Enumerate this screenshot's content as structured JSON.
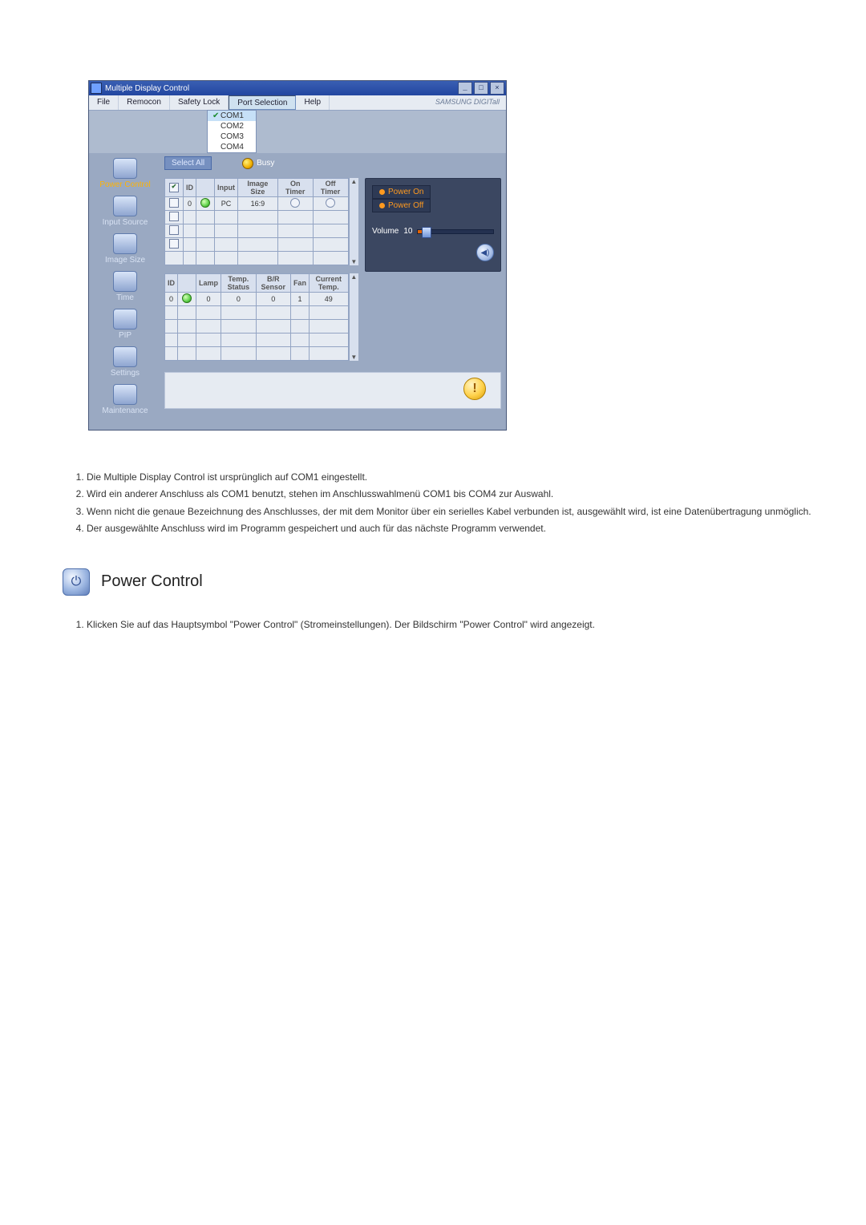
{
  "app": {
    "title": "Multiple Display Control",
    "brand": "SAMSUNG DIGITall",
    "menus": [
      "File",
      "Remocon",
      "Safety Lock",
      "Port Selection",
      "Help"
    ],
    "port_selection_active": true,
    "ports": [
      "COM1",
      "COM2",
      "COM3",
      "COM4"
    ],
    "ports_selected": "COM1",
    "select_all_label": "Select All",
    "busy_label": "Busy",
    "sidebar": [
      {
        "label": "Power Control",
        "active": true
      },
      {
        "label": "Input Source"
      },
      {
        "label": "Image Size"
      },
      {
        "label": "Time"
      },
      {
        "label": "PIP"
      },
      {
        "label": "Settings"
      },
      {
        "label": "Maintenance"
      }
    ],
    "table1": {
      "headers": [
        "",
        "ID",
        "",
        "Input",
        "Image Size",
        "On Timer",
        "Off Timer"
      ],
      "rows": [
        {
          "checked": false,
          "id": "0",
          "power": "on",
          "input": "PC",
          "image_size": "16:9",
          "on_timer": "○",
          "off_timer": "○"
        },
        {
          "checked": false
        },
        {
          "checked": false
        },
        {
          "checked": false
        }
      ]
    },
    "table2": {
      "headers": [
        "ID",
        "",
        "Lamp",
        "Temp. Status",
        "B/R Sensor",
        "Fan",
        "Current Temp."
      ],
      "rows": [
        {
          "id": "0",
          "power": "on",
          "lamp": "0",
          "temp_status": "0",
          "br_sensor": "0",
          "fan": "1",
          "current_temp": "49"
        },
        {},
        {},
        {}
      ]
    },
    "right": {
      "power_on": "Power On",
      "power_off": "Power Off",
      "volume_label": "Volume",
      "volume_value": 10,
      "volume_max": 100
    }
  },
  "doc": {
    "items1": [
      "Die Multiple Display Control ist ursprünglich auf COM1 eingestellt.",
      "Wird ein anderer Anschluss als COM1 benutzt, stehen im Anschlusswahlmenü COM1 bis COM4 zur Auswahl.",
      "Wenn nicht die genaue Bezeichnung des Anschlusses, der mit dem Monitor über ein serielles Kabel verbunden ist, ausgewählt wird, ist eine Datenübertragung unmöglich.",
      "Der ausgewählte Anschluss wird im Programm gespeichert und auch für das nächste Programm verwendet."
    ],
    "heading": "Power Control",
    "items2": [
      "Klicken Sie auf das Hauptsymbol \"Power Control\" (Stromeinstellungen). Der Bildschirm \"Power Control\" wird angezeigt."
    ]
  }
}
